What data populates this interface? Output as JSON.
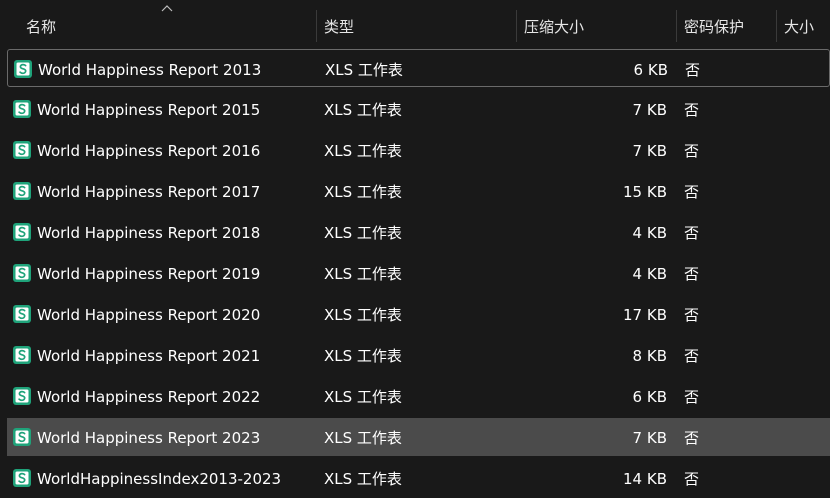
{
  "columns": {
    "name": "名称",
    "type": "类型",
    "compressed_size": "压缩大小",
    "password": "密码保护",
    "size": "大小"
  },
  "sort": {
    "column": "name",
    "direction": "ascending"
  },
  "files": [
    {
      "name": "World Happiness Report 2013",
      "type": "XLS 工作表",
      "compressed_size": "6 KB",
      "password": "否",
      "icon": "spreadsheet-icon"
    },
    {
      "name": "World Happiness Report 2015",
      "type": "XLS 工作表",
      "compressed_size": "7 KB",
      "password": "否",
      "icon": "spreadsheet-icon"
    },
    {
      "name": "World Happiness Report 2016",
      "type": "XLS 工作表",
      "compressed_size": "7 KB",
      "password": "否",
      "icon": "spreadsheet-icon"
    },
    {
      "name": "World Happiness Report 2017",
      "type": "XLS 工作表",
      "compressed_size": "15 KB",
      "password": "否",
      "icon": "spreadsheet-icon"
    },
    {
      "name": "World Happiness Report 2018",
      "type": "XLS 工作表",
      "compressed_size": "4 KB",
      "password": "否",
      "icon": "spreadsheet-icon"
    },
    {
      "name": "World Happiness Report 2019",
      "type": "XLS 工作表",
      "compressed_size": "4 KB",
      "password": "否",
      "icon": "spreadsheet-icon"
    },
    {
      "name": "World Happiness Report 2020",
      "type": "XLS 工作表",
      "compressed_size": "17 KB",
      "password": "否",
      "icon": "spreadsheet-icon"
    },
    {
      "name": "World Happiness Report 2021",
      "type": "XLS 工作表",
      "compressed_size": "8 KB",
      "password": "否",
      "icon": "spreadsheet-icon"
    },
    {
      "name": "World Happiness Report 2022",
      "type": "XLS 工作表",
      "compressed_size": "6 KB",
      "password": "否",
      "icon": "spreadsheet-icon"
    },
    {
      "name": "World Happiness Report 2023",
      "type": "XLS 工作表",
      "compressed_size": "7 KB",
      "password": "否",
      "icon": "spreadsheet-icon"
    },
    {
      "name": "WorldHappinessIndex2013-2023",
      "type": "XLS 工作表",
      "compressed_size": "14 KB",
      "password": "否",
      "icon": "spreadsheet-icon"
    }
  ],
  "focused_index": 0,
  "selected_index": 9,
  "colors": {
    "background": "#191919",
    "selected_row": "#4b4b4b",
    "focus_border": "#6a6a6a",
    "icon_green": "#1fa37a"
  }
}
